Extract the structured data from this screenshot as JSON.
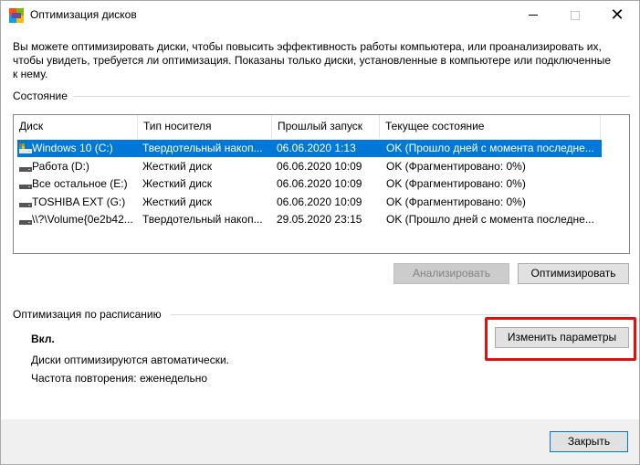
{
  "window": {
    "title": "Оптимизация дисков",
    "icon": "defrag-app-icon"
  },
  "description": "Вы можете оптимизировать диски, чтобы повысить эффективность работы  компьютера, или проанализировать их, чтобы увидеть, требуется ли оптимизация. Показаны только диски, установленные в компьютере или подключенные к нему.",
  "status": {
    "label": "Состояние",
    "columns": [
      "Диск",
      "Тип носителя",
      "Прошлый запуск",
      "Текущее состояние"
    ],
    "rows": [
      {
        "disk": "Windows 10 (C:)",
        "type": "Твердотельный накоп...",
        "last_run": "06.06.2020 1:13",
        "state": "OK (Прошло дней с момента последне...",
        "icon": "system-drive-icon",
        "selected": true
      },
      {
        "disk": "Работа (D:)",
        "type": "Жесткий диск",
        "last_run": "06.06.2020 10:09",
        "state": "OK (Фрагментировано: 0%)",
        "icon": "hard-drive-icon",
        "selected": false
      },
      {
        "disk": "Все остальное (E:)",
        "type": "Жесткий диск",
        "last_run": "06.06.2020 10:09",
        "state": "OK (Фрагментировано: 0%)",
        "icon": "hard-drive-icon",
        "selected": false
      },
      {
        "disk": "TOSHIBA EXT (G:)",
        "type": "Жесткий диск",
        "last_run": "06.06.2020 10:09",
        "state": "OK (Фрагментировано: 0%)",
        "icon": "hard-drive-icon",
        "selected": false
      },
      {
        "disk": "\\\\?\\Volume{0e2b42...",
        "type": "Твердотельный накоп...",
        "last_run": "29.05.2020 23:15",
        "state": "OK (Прошло дней с момента последне...",
        "icon": "hard-drive-icon",
        "selected": false
      }
    ],
    "analyze_label": "Анализировать",
    "optimize_label": "Оптимизировать"
  },
  "schedule": {
    "label": "Оптимизация по расписанию",
    "state": "Вкл.",
    "auto_text": "Диски оптимизируются автоматически.",
    "frequency_text": "Частота повторения: еженедельно",
    "change_label": "Изменить параметры"
  },
  "footer": {
    "close_label": "Закрыть"
  },
  "colors": {
    "selection": "#0078d7",
    "highlight_box": "#e01010"
  }
}
